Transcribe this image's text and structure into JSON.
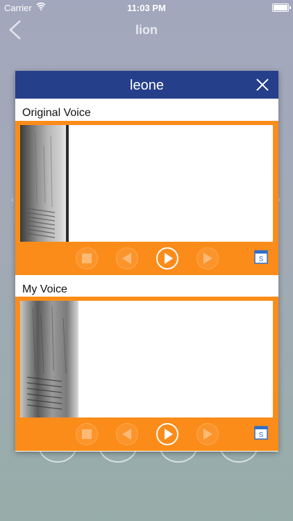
{
  "status_bar": {
    "carrier": "Carrier",
    "time": "11:03 PM"
  },
  "nav": {
    "title": "lion"
  },
  "modal": {
    "title": "leone",
    "sections": [
      {
        "label": "Original Voice"
      },
      {
        "label": "My Voice"
      }
    ]
  },
  "colors": {
    "header": "#253f8b",
    "panel": "#fb8c1a",
    "save_icon": "#2f6fc9"
  }
}
